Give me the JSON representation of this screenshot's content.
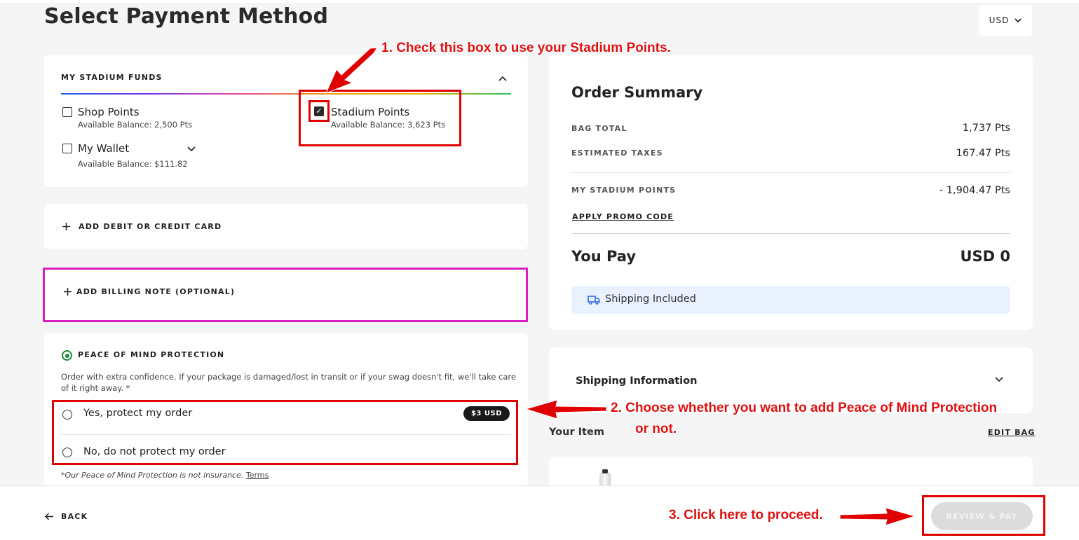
{
  "page": {
    "title": "Select Payment Method",
    "currency": "USD"
  },
  "funds": {
    "heading": "MY STADIUM FUNDS",
    "shop_points": {
      "name": "Shop Points",
      "balance": "Available Balance: 2,500 Pts",
      "checked": false
    },
    "stadium_points": {
      "name": "Stadium Points",
      "balance": "Available Balance: 3,623 Pts",
      "checked": true
    },
    "wallet": {
      "name": "My Wallet",
      "balance": "Available Balance: $111.82",
      "checked": false
    }
  },
  "add_card": {
    "label": "ADD DEBIT OR CREDIT CARD"
  },
  "billing_note": {
    "label": "ADD BILLING NOTE (OPTIONAL)"
  },
  "protection": {
    "heading": "PEACE OF MIND PROTECTION",
    "description": "Order with extra confidence. If your package is damaged/lost in transit or if your swag doesn't fit, we'll take care of it right away. *",
    "option_yes": "Yes, protect my order",
    "option_yes_price": "$3 USD",
    "option_no": "No, do not protect my order",
    "footnote": "*Our Peace of Mind Protection is not insurance.",
    "terms_link": "Terms"
  },
  "summary": {
    "title": "Order Summary",
    "bag_total_label": "BAG TOTAL",
    "bag_total_value": "1,737 Pts",
    "taxes_label": "ESTIMATED TAXES",
    "taxes_value": "167.47 Pts",
    "points_label": "MY STADIUM POINTS",
    "points_value": "- 1,904.47 Pts",
    "promo_link": "APPLY PROMO CODE",
    "you_pay_label": "You Pay",
    "you_pay_value": "USD 0",
    "shipping_banner": "Shipping Included"
  },
  "shipping_info": {
    "title": "Shipping Information"
  },
  "your_item": {
    "label": "Your Item",
    "edit_link": "EDIT BAG"
  },
  "footer": {
    "back_label": "BACK",
    "review_label": "REVIEW & PAY"
  },
  "annotations": {
    "step1": "1. Check this box to use your Stadium Points.",
    "step2_line1": "2. Choose whether you want to add Peace of Mind Protection",
    "step2_line2": "or not.",
    "step3": "3. Click here to proceed."
  },
  "colors": {
    "annotation_red": "#e00000",
    "highlight_magenta": "#d91fc4",
    "protection_green": "#1f8a3a",
    "shipping_banner_bg": "#e8f1fd"
  }
}
